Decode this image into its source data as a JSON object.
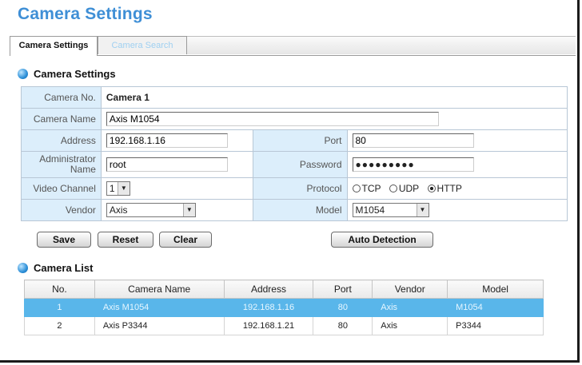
{
  "page_title": "Camera Settings",
  "tabs": [
    {
      "label": "Camera Settings",
      "active": true
    },
    {
      "label": "Camera Search",
      "active": false
    }
  ],
  "settings_section": {
    "title": "Camera Settings",
    "camera_no_label": "Camera No.",
    "camera_no_value": "Camera 1",
    "camera_name_label": "Camera Name",
    "camera_name_value": "Axis M1054",
    "address_label": "Address",
    "address_value": "192.168.1.16",
    "port_label": "Port",
    "port_value": "80",
    "admin_label_line1": "Administrator",
    "admin_label_line2": "Name",
    "admin_value": "root",
    "password_label": "Password",
    "password_value": "●●●●●●●●●",
    "video_channel_label": "Video Channel",
    "video_channel_value": "1",
    "protocol_label": "Protocol",
    "protocol_options": [
      "TCP",
      "UDP",
      "HTTP"
    ],
    "protocol_selected": "HTTP",
    "vendor_label": "Vendor",
    "vendor_value": "Axis",
    "model_label": "Model",
    "model_value": "M1054"
  },
  "buttons": {
    "save": "Save",
    "reset": "Reset",
    "clear": "Clear",
    "auto_detection": "Auto Detection"
  },
  "list_section": {
    "title": "Camera List",
    "columns": [
      "No.",
      "Camera Name",
      "Address",
      "Port",
      "Vendor",
      "Model"
    ],
    "rows": [
      {
        "no": "1",
        "name": "Axis M1054",
        "address": "192.168.1.16",
        "port": "80",
        "vendor": "Axis",
        "model": "M1054",
        "selected": true
      },
      {
        "no": "2",
        "name": "Axis P3344",
        "address": "192.168.1.21",
        "port": "80",
        "vendor": "Axis",
        "model": "P3344",
        "selected": false
      }
    ]
  },
  "colors": {
    "title_blue": "#3f8fd6",
    "label_cell_bg": "#dceefb",
    "selected_row_bg": "#59b6ea",
    "inactive_tab_text": "#9fd0f1"
  }
}
